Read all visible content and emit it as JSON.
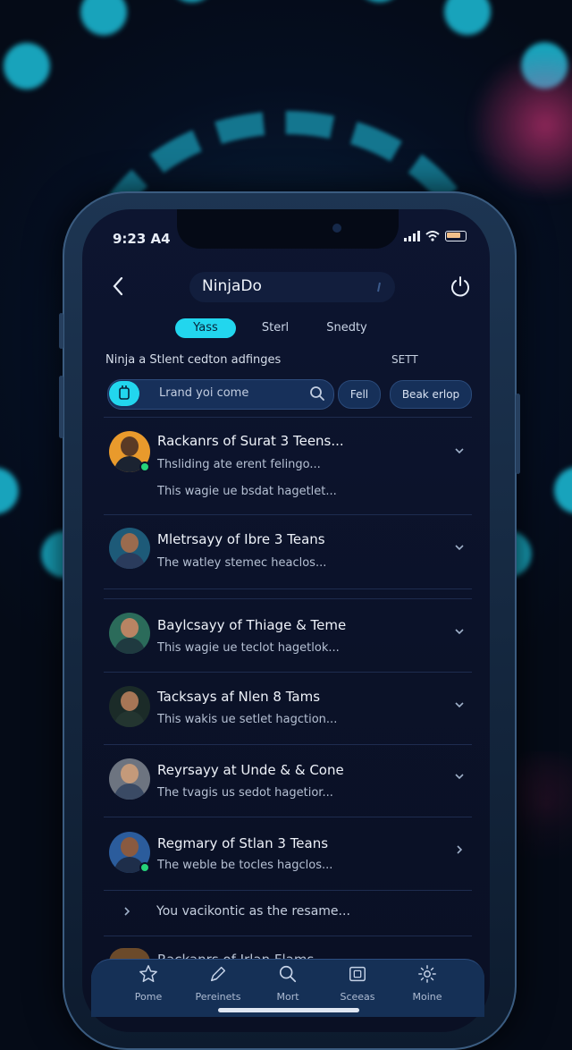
{
  "status": {
    "time": "9:23 A4"
  },
  "header": {
    "title": "NinjaDo"
  },
  "tabs": [
    {
      "label": "Yass",
      "active": true
    },
    {
      "label": "Sterl",
      "active": false
    },
    {
      "label": "Snedty",
      "active": false
    }
  ],
  "subheading": "Ninja a Stlent cedton adfinges",
  "sett_label": "SETT",
  "search": {
    "value": "Lrand yoi come"
  },
  "chips": [
    "Fell",
    "Beak erlop"
  ],
  "list": [
    {
      "title": "Rackanrs of Surat 3 Teens...",
      "line1": "Thsliding ate erent felingo...",
      "line2": "This wagie ue bsdat hagetlet..."
    },
    {
      "title": "Mletrsayy of Ibre 3 Teans",
      "line1": "The watley stemec heaclos..."
    },
    {
      "title": "Baylcsayy of Thiage & Teme",
      "line1": "This wagie ue teclot hagetlok..."
    },
    {
      "title": "Tacksays af Nlen 8 Tams",
      "line1": "This wakis ue setlet hagction..."
    },
    {
      "title": "Reyrsayy at Unde & & Cone",
      "line1": "The tvagis us sedot hagetior..."
    },
    {
      "title": "Regmary of Stlan 3 Teans",
      "line1": "The weble be tocles hagclos..."
    }
  ],
  "expander": {
    "text": "You vacikontic as the resame..."
  },
  "peek_title": "Rackanrs of Irlan Flams",
  "nav": [
    {
      "label": "Pome",
      "icon": "star-icon"
    },
    {
      "label": "Pereinets",
      "icon": "pen-icon"
    },
    {
      "label": "Mort",
      "icon": "search-icon"
    },
    {
      "label": "Sceeas",
      "icon": "tablet-icon"
    },
    {
      "label": "Moine",
      "icon": "gear-icon"
    }
  ],
  "colors": {
    "accent": "#22d6ee",
    "background": "#0b1229",
    "nav": "#153056"
  }
}
